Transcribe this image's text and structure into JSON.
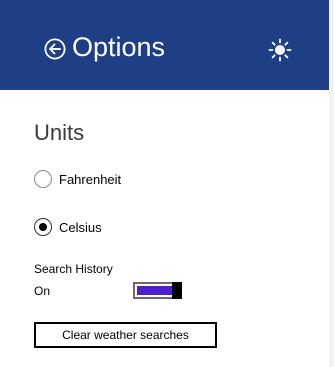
{
  "header": {
    "title": "Options",
    "back_icon": "back-arrow-circle-icon",
    "brightness_icon": "sun-icon",
    "background_color": "#1e3f86"
  },
  "units": {
    "title": "Units",
    "options": [
      {
        "label": "Fahrenheit",
        "selected": false
      },
      {
        "label": "Celsius",
        "selected": true
      }
    ]
  },
  "search_history": {
    "label": "Search History",
    "state": "On",
    "enabled": true,
    "toggle_color": "#4f1ed0"
  },
  "actions": {
    "clear_label": "Clear weather searches"
  }
}
